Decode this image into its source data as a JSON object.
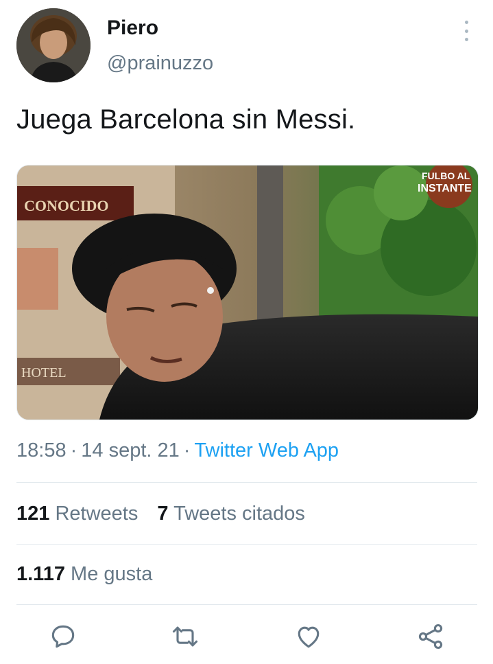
{
  "author": {
    "name": "Piero",
    "handle": "@prainuzzo"
  },
  "tweet": {
    "text": "Juega Barcelona sin Messi."
  },
  "media": {
    "sign_text": "CONOCIDO",
    "hotel_text": "HOTEL",
    "watermark_line1": "FULBO AL",
    "watermark_line2": "INSTANTE"
  },
  "meta": {
    "time": "18:58",
    "date": "14 sept. 21",
    "separator": "·",
    "source": "Twitter Web App"
  },
  "stats": {
    "retweets_count": "121",
    "retweets_label": "Retweets",
    "quotes_count": "7",
    "quotes_label": "Tweets citados",
    "likes_count": "1.117",
    "likes_label": "Me gusta"
  },
  "icons": {
    "reply": "reply-icon",
    "retweet": "retweet-icon",
    "like": "heart-icon",
    "share": "share-icon",
    "more": "more-vertical-icon"
  },
  "colors": {
    "text_primary": "#14171a",
    "text_secondary": "#657786",
    "accent": "#1da1f2",
    "divider": "#e1e8ed",
    "icon": "#657786"
  }
}
